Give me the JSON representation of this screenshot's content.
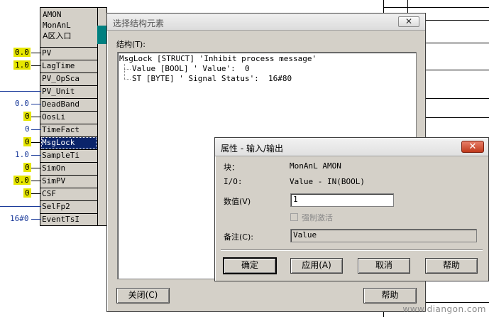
{
  "block": {
    "type": "AMON",
    "name": "MonAnL",
    "subtitle": "A区入口",
    "pins": [
      {
        "label": "PV",
        "value": "0.0",
        "style": "yellow"
      },
      {
        "label": "LagTime",
        "value": "1.0",
        "style": "yellow"
      },
      {
        "label": "PV_OpSca",
        "value": "",
        "style": "none"
      },
      {
        "label": "PV_Unit",
        "value": "",
        "style": "line"
      },
      {
        "label": "DeadBand",
        "value": "0.0",
        "style": "blue"
      },
      {
        "label": "OosLi",
        "value": "0",
        "style": "yellow"
      },
      {
        "label": "TimeFact",
        "value": "0",
        "style": "blue"
      },
      {
        "label": "MsgLock",
        "value": "0",
        "style": "yellow",
        "selected": true
      },
      {
        "label": "SampleTi",
        "value": "1.0",
        "style": "blue"
      },
      {
        "label": "SimOn",
        "value": "0",
        "style": "yellow"
      },
      {
        "label": "SimPV",
        "value": "0.0",
        "style": "yellow"
      },
      {
        "label": "CSF",
        "value": "0",
        "style": "yellow"
      },
      {
        "label": "SelFp2",
        "value": "",
        "style": "line"
      },
      {
        "label": "EventTsI",
        "value": "16#0",
        "style": "blue"
      }
    ]
  },
  "struct_dialog": {
    "title": "选择结构元素",
    "close_glyph": "✕",
    "structure_label": "结构(T):",
    "tree": [
      "MsgLock [STRUCT] 'Inhibit process message'",
      "Value [BOOL] ' Value':  0",
      "ST [BYTE] ' Signal Status':  16#80"
    ],
    "close_button": "关闭(C)",
    "help_button": "帮助"
  },
  "prop_dialog": {
    "title": "属性 - 输入/输出",
    "close_glyph": "✕",
    "block_label": "块：",
    "block_value": "MonAnL AMON",
    "io_label": "I/O:",
    "io_value": "Value  -  IN(BOOL)",
    "value_label": "数值(V)",
    "value_input": "1",
    "force_label": "强制激活",
    "comment_label": "备注(C):",
    "comment_value": "Value",
    "buttons": {
      "ok": "确定",
      "apply": "应用(A)",
      "cancel": "取消",
      "help": "帮助"
    }
  },
  "watermark": "www.diangon.com",
  "colors": {
    "accent_yellow": "#e6e600",
    "selection": "#0a246a",
    "close_red": "#c0391b"
  }
}
